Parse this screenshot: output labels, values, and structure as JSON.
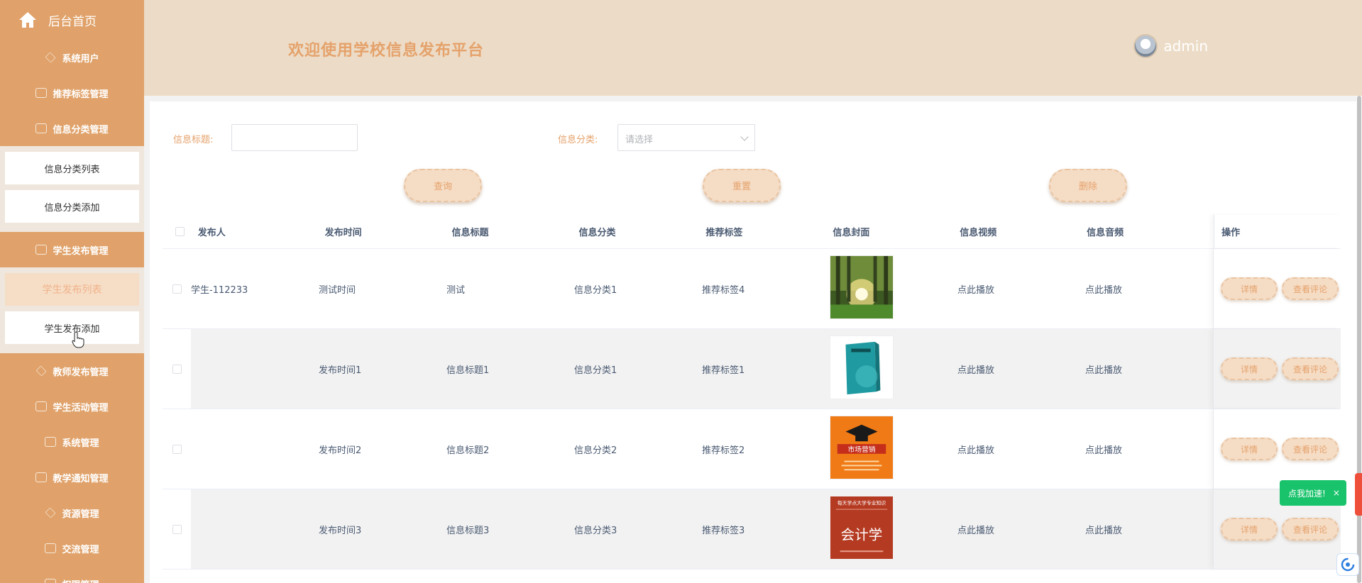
{
  "sidebar": {
    "home_label": "后台首页",
    "items": [
      {
        "label": "系统用户",
        "icon": "diamond-icon"
      },
      {
        "label": "推荐标签管理",
        "icon": "edit-icon"
      },
      {
        "label": "信息分类管理",
        "icon": "chart-icon"
      }
    ],
    "sub1": [
      "信息分类列表",
      "信息分类添加"
    ],
    "item_student": {
      "label": "学生发布管理",
      "icon": "edit-icon"
    },
    "sub2": [
      {
        "label": "学生发布列表",
        "active": true
      },
      {
        "label": "学生发布添加",
        "active": false
      }
    ],
    "items_after": [
      {
        "label": "教师发布管理",
        "icon": "diamond-icon"
      },
      {
        "label": "学生活动管理",
        "icon": "chart-icon"
      },
      {
        "label": "系统管理",
        "icon": "doc-icon"
      },
      {
        "label": "教学通知管理",
        "icon": "edit-icon"
      },
      {
        "label": "资源管理",
        "icon": "diamond-icon"
      },
      {
        "label": "交流管理",
        "icon": "edit-icon"
      },
      {
        "label": "权限管理",
        "icon": "doc-icon"
      }
    ]
  },
  "header": {
    "title": "欢迎使用学校信息发布平台",
    "username": "admin"
  },
  "search": {
    "title_label": "信息标题:",
    "title_value": "",
    "category_label": "信息分类:",
    "category_placeholder": "请选择",
    "query_btn": "查询",
    "reset_btn": "重置",
    "delete_btn": "删除"
  },
  "table": {
    "headers": [
      "发布人",
      "发布时间",
      "信息标题",
      "信息分类",
      "推荐标签",
      "信息封面",
      "信息视频",
      "信息音频",
      "操作"
    ],
    "rows": [
      {
        "publisher": "学生-112233",
        "time": "测试时间",
        "title": "测试",
        "category": "信息分类1",
        "tag": "推荐标签4",
        "cover": "forest-sunlight",
        "video": "点此播放",
        "audio": "点此播放"
      },
      {
        "publisher": "",
        "time": "发布时间1",
        "title": "信息标题1",
        "category": "信息分类1",
        "tag": "推荐标签1",
        "cover": "teal-book",
        "video": "点此播放",
        "audio": "点此播放"
      },
      {
        "publisher": "",
        "time": "发布时间2",
        "title": "信息标题2",
        "category": "信息分类2",
        "tag": "推荐标签2",
        "cover": "marketing-book",
        "video": "点此播放",
        "audio": "点此播放"
      },
      {
        "publisher": "",
        "time": "发布时间3",
        "title": "信息标题3",
        "category": "信息分类3",
        "tag": "推荐标签3",
        "cover": "accounting-book",
        "video": "点此播放",
        "audio": "点此播放"
      }
    ],
    "detail_btn": "详情",
    "comment_btn": "查看评论",
    "cover_texts": {
      "marketing": "市场营销",
      "accounting_top": "每天学点大学专业知识",
      "accounting_main": "会计学"
    }
  },
  "float": {
    "speed_label": "点我加速!",
    "close": "×"
  },
  "colors": {
    "sidebar": "#e0a26a",
    "header": "#ecdcc7",
    "accent": "#e5a26b",
    "button_bg": "#f5dcc5"
  }
}
